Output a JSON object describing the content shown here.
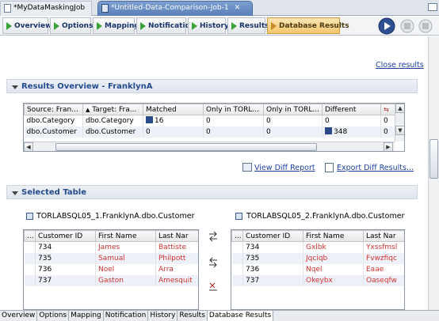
{
  "editor_tabs": [
    {
      "label": "*MyDataMaskingJob"
    },
    {
      "label": "*Untitled-Data-Comparison-Job-1"
    }
  ],
  "steps": [
    "Overview",
    "Options",
    "Mapping",
    "Notification",
    "History",
    "Results",
    "Database Results"
  ],
  "current_step": "Database Results",
  "close_results": "Close results",
  "results_overview": {
    "title": "Results Overview - FranklynA",
    "columns": [
      "Source: Fran...",
      "Target: Fra...",
      "Matched",
      "Only in TORL...",
      "Only in TORL...",
      "Different",
      ""
    ],
    "rows": [
      {
        "source": "dbo.Category",
        "target": "dbo.Category",
        "matched": "16",
        "only1": "0",
        "only2": "0",
        "different": "0",
        "extra": "0"
      },
      {
        "source": "dbo.Customer",
        "target": "dbo.Customer",
        "matched": "0",
        "only1": "0",
        "only2": "0",
        "different": "348",
        "extra": "0"
      }
    ]
  },
  "actions": {
    "view_diff": "View Diff Report",
    "export_diff": "Export Diff Results..."
  },
  "selected_table": {
    "title": "Selected Table",
    "left": {
      "name": "TORLABSQL05_1.FranklynA.dbo.Customer",
      "columns": [
        "...",
        "Customer ID",
        "First Name",
        "Last Nar"
      ],
      "rows": [
        {
          "id": "734",
          "first": "James",
          "last": "Battiste"
        },
        {
          "id": "735",
          "first": "Samual",
          "last": "Philpott"
        },
        {
          "id": "736",
          "first": "Noel",
          "last": "Arra"
        },
        {
          "id": "737",
          "first": "Gaston",
          "last": "Amesquit"
        }
      ]
    },
    "right": {
      "name": "TORLABSQL05_2.FranklynA.dbo.Customer",
      "columns": [
        "...",
        "Customer ID",
        "First Name",
        "Last Nar"
      ],
      "rows": [
        {
          "id": "734",
          "first": "Gxlbk",
          "last": "Yxssfmsl"
        },
        {
          "id": "735",
          "first": "Jqciqb",
          "last": "Fvwzfiqc"
        },
        {
          "id": "736",
          "first": "Nqel",
          "last": "Eaae"
        },
        {
          "id": "737",
          "first": "Okeybx",
          "last": "Oaseqfw"
        }
      ]
    }
  },
  "bottom_tabs": [
    "Overview",
    "Options",
    "Mapping",
    "Notification",
    "History",
    "Results",
    "Database Results"
  ],
  "colors": {
    "accent": "#254b8f",
    "diff_text": "#d03030",
    "active_tab": "#5a7fba"
  }
}
